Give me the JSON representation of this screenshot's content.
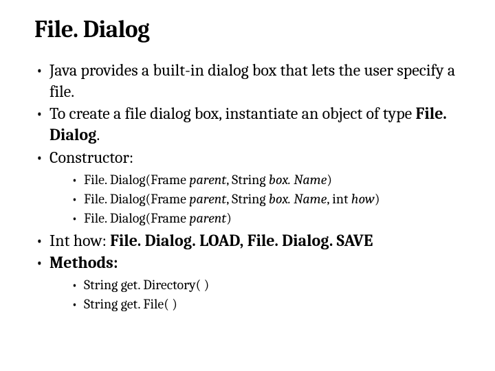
{
  "title": "File. Dialog",
  "bullets": {
    "b1": "Java provides a built-in dialog box that lets the user specify a file.",
    "b2_pre": "To create a file dialog box, instantiate an object of type ",
    "b2_bold": "File. Dialog",
    "b2_post": ".",
    "b3": "Constructor:",
    "c1_pre": "File. Dialog(Frame ",
    "c1_i1": "parent",
    "c1_mid": ", String ",
    "c1_i2": "box. Name",
    "c1_post": ")",
    "c2_pre": "File. Dialog(Frame ",
    "c2_i1": "parent",
    "c2_mid1": ", String ",
    "c2_i2": "box. Name",
    "c2_mid2": ", int ",
    "c2_i3": "how",
    "c2_post": ")",
    "c3_pre": "File. Dialog(Frame ",
    "c3_i1": "parent",
    "c3_post": ")",
    "b4_pre": "Int how: ",
    "b4_bold": "File. Dialog. LOAD, File. Dialog. SAVE",
    "b5": "Methods:",
    "m1": "String get. Directory( )",
    "m2": "String get. File( )"
  }
}
